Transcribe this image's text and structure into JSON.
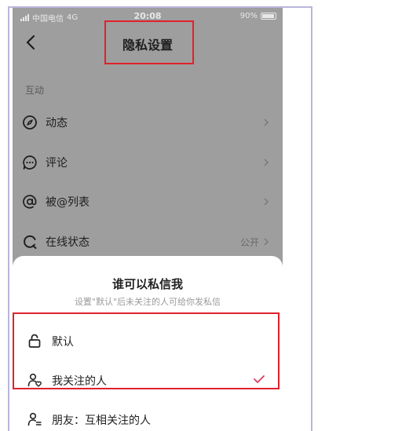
{
  "status_bar": {
    "carrier": "中国电信",
    "network": "4G",
    "time": "20:08",
    "battery": "90%"
  },
  "header": {
    "title": "隐私设置"
  },
  "sections": {
    "interaction": {
      "header": "互动",
      "items": [
        {
          "label": "动态",
          "icon": "compass-icon"
        },
        {
          "label": "评论",
          "icon": "comment-icon"
        },
        {
          "label": "被@列表",
          "icon": "at-icon"
        },
        {
          "label": "在线状态",
          "icon": "online-status-icon",
          "value": "公开"
        }
      ]
    }
  },
  "sheet": {
    "title": "谁可以私信我",
    "subtitle": "设置\"默认\"后未关注的人可给你发私信",
    "options": [
      {
        "label": "默认",
        "icon": "unlock-icon",
        "selected": false
      },
      {
        "label": "我关注的人",
        "icon": "person-heart-icon",
        "selected": true
      },
      {
        "label": "朋友：互相关注的人",
        "icon": "person-mutual-icon",
        "selected": false
      }
    ]
  },
  "colors": {
    "overlay": "#9e9e9e",
    "highlight": "#e0212b",
    "accent": "#e23a5e"
  }
}
